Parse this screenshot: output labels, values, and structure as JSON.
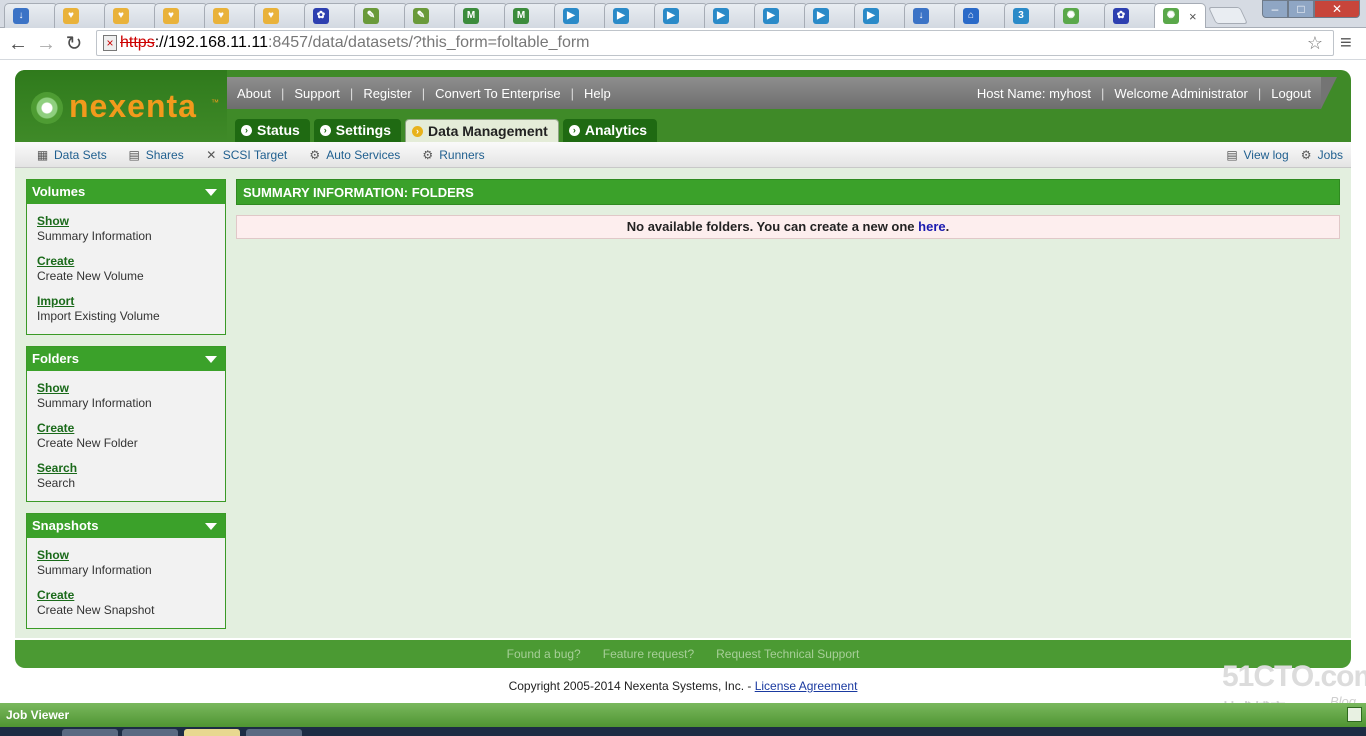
{
  "browser": {
    "tabs": [
      {
        "icon": "page-icon",
        "color": "#3b73c6",
        "glyph": "↓"
      },
      {
        "icon": "nexenta-icon",
        "color": "#e9b23a",
        "glyph": "♥"
      },
      {
        "icon": "nexenta-icon",
        "color": "#e9b23a",
        "glyph": "♥"
      },
      {
        "icon": "nexenta-icon",
        "color": "#e9b23a",
        "glyph": "♥"
      },
      {
        "icon": "nexenta-icon",
        "color": "#e9b23a",
        "glyph": "♥"
      },
      {
        "icon": "nexenta-icon",
        "color": "#e9b23a",
        "glyph": "♥"
      },
      {
        "icon": "paw-icon",
        "color": "#2d3fb0",
        "glyph": "✿"
      },
      {
        "icon": "pencil-icon",
        "color": "#6a9a3a",
        "glyph": "✎"
      },
      {
        "icon": "pencil-icon",
        "color": "#6a9a3a",
        "glyph": "✎"
      },
      {
        "icon": "mx-icon",
        "color": "#3c8c3c",
        "glyph": "M"
      },
      {
        "icon": "mx-icon",
        "color": "#3c8c3c",
        "glyph": "M"
      },
      {
        "icon": "play-icon",
        "color": "#2a8ac8",
        "glyph": "▶"
      },
      {
        "icon": "play-icon",
        "color": "#2a8ac8",
        "glyph": "▶"
      },
      {
        "icon": "play-icon",
        "color": "#2a8ac8",
        "glyph": "▶"
      },
      {
        "icon": "play-icon",
        "color": "#2a8ac8",
        "glyph": "▶"
      },
      {
        "icon": "play-icon",
        "color": "#2a8ac8",
        "glyph": "▶"
      },
      {
        "icon": "play-icon",
        "color": "#2a8ac8",
        "glyph": "▶"
      },
      {
        "icon": "play-icon",
        "color": "#2a8ac8",
        "glyph": "▶"
      },
      {
        "icon": "page-icon",
        "color": "#3b73c6",
        "glyph": "↓"
      },
      {
        "icon": "home-icon",
        "color": "#2a6ac8",
        "glyph": "⌂"
      },
      {
        "icon": "page-icon",
        "color": "#2a8ac8",
        "glyph": "3"
      },
      {
        "icon": "nexenta-swirl-icon",
        "color": "#5aa84a",
        "glyph": "✺"
      },
      {
        "icon": "paw-icon",
        "color": "#2d3fb0",
        "glyph": "✿"
      },
      {
        "icon": "nexenta-swirl-icon",
        "color": "#5aa84a",
        "glyph": "✺",
        "active": true
      }
    ],
    "close_tab": "×",
    "window": {
      "minimize": "–",
      "maximize": "□",
      "close": "✕"
    },
    "nav": {
      "back": "←",
      "forward": "→",
      "reload": "↻"
    },
    "url": {
      "protocol": "https",
      "host": "://192.168.11.11",
      "rest": ":8457/data/datasets/?this_form=foltable_form"
    },
    "star": "☆",
    "menu": "≡"
  },
  "app": {
    "logo": "nexenta",
    "logo_tm": "™",
    "topnav": [
      "About",
      "Support",
      "Register",
      "Convert To Enterprise",
      "Help"
    ],
    "host_label": "Host Name: myhost",
    "welcome": "Welcome Administrator",
    "logout": "Logout",
    "separator": "|",
    "main_tabs": [
      {
        "label": "Status",
        "active": false
      },
      {
        "label": "Settings",
        "active": false
      },
      {
        "label": "Data Management",
        "active": true
      },
      {
        "label": "Analytics",
        "active": false
      }
    ],
    "subnav": [
      {
        "label": "Data Sets",
        "icon": "datasets-icon",
        "glyph": "▦"
      },
      {
        "label": "Shares",
        "icon": "shares-icon",
        "glyph": "▤"
      },
      {
        "label": "SCSI Target",
        "icon": "tools-icon",
        "glyph": "✕"
      },
      {
        "label": "Auto Services",
        "icon": "gear-icon",
        "glyph": "⚙"
      },
      {
        "label": "Runners",
        "icon": "runners-icon",
        "glyph": "⚙"
      }
    ],
    "subnav_right": [
      {
        "label": "View log",
        "icon": "log-icon",
        "glyph": "▤"
      },
      {
        "label": "Jobs",
        "icon": "gear-icon",
        "glyph": "⚙"
      }
    ],
    "sidebar": [
      {
        "title": "Volumes",
        "entries": [
          {
            "link": "Show",
            "desc": "Summary Information"
          },
          {
            "link": "Create",
            "desc": "Create New Volume"
          },
          {
            "link": "Import",
            "desc": "Import Existing Volume"
          }
        ]
      },
      {
        "title": "Folders",
        "entries": [
          {
            "link": "Show",
            "desc": "Summary Information"
          },
          {
            "link": "Create",
            "desc": "Create New Folder"
          },
          {
            "link": "Search",
            "desc": "Search"
          }
        ]
      },
      {
        "title": "Snapshots",
        "entries": [
          {
            "link": "Show",
            "desc": "Summary Information"
          },
          {
            "link": "Create",
            "desc": "Create New Snapshot"
          }
        ]
      }
    ],
    "panel_title": "SUMMARY INFORMATION: FOLDERS",
    "message_prefix": "No available folders. You can create a new one ",
    "message_link": "here",
    "message_suffix": ".",
    "footer_links": [
      "Found a bug?",
      "Feature request?",
      "Request Technical Support"
    ],
    "copyright": "Copyright 2005-2014 Nexenta Systems, Inc. - ",
    "license": "License Agreement",
    "job_viewer": "Job Viewer"
  },
  "watermark": {
    "big": "51CTO.com",
    "small": "技术博客",
    "blog": "Blog"
  },
  "colors": {
    "brand_green": "#3ba12a",
    "header_green": "#3f8a28",
    "logo_orange": "#f29a1c",
    "content_bg": "#e3efdf"
  }
}
